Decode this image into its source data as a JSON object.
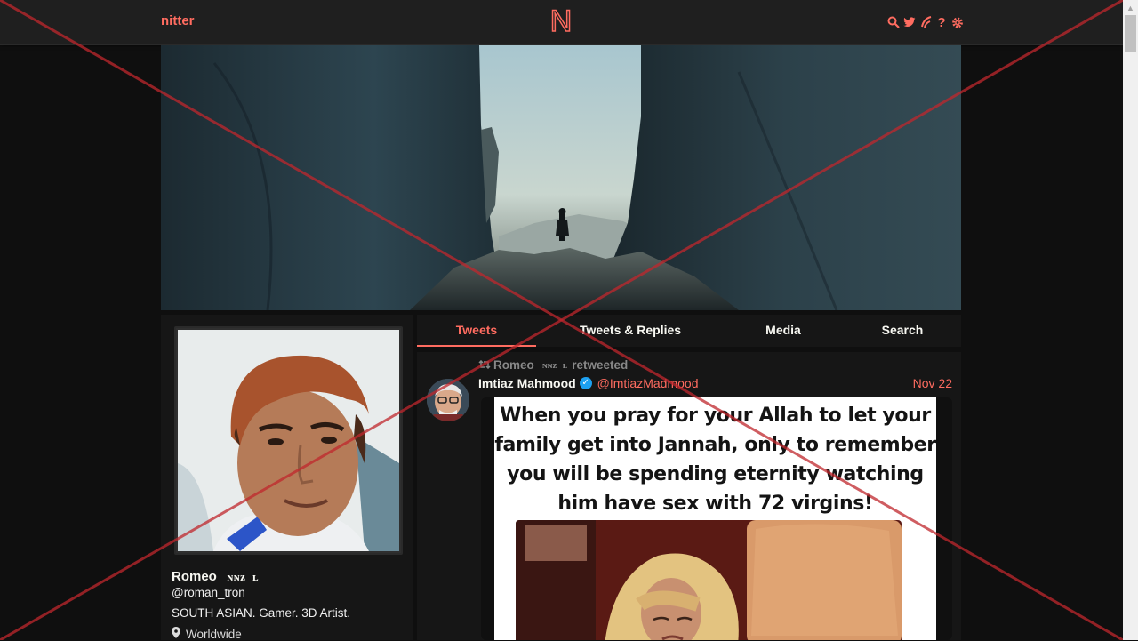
{
  "navbar": {
    "brand": "nitter",
    "icons": [
      "search-icon",
      "twitter-bird-icon",
      "rss-icon",
      "help-icon",
      "gear-icon"
    ]
  },
  "profile": {
    "fullname": "Romeo",
    "fullname_deco": "ɪɴɴᴢɪʟ",
    "username": "@roman_tron",
    "bio": "SOUTH ASIAN. Gamer. 3D Artist.",
    "location": "Worldwide"
  },
  "tabs": [
    {
      "label": "Tweets",
      "active": true
    },
    {
      "label": "Tweets & Replies",
      "active": false
    },
    {
      "label": "Media",
      "active": false
    },
    {
      "label": "Search",
      "active": false
    }
  ],
  "tweet": {
    "retweeter": "Romeo",
    "retweeter_deco": "ɪɴɴᴢɪʟ",
    "retweet_suffix": "retweeted",
    "author_name": "Imtiaz Mahmood",
    "author_handle": "@ImtiazMadmood",
    "date": "Nov 22",
    "verified": true,
    "image_text": "When you pray for your Allah to let your family get into Jannah, only to remember you will be spending eternity watching him have sex with 72 virgins!"
  },
  "colors": {
    "accent": "#ff6c60",
    "background": "#0f0f0f",
    "panel": "#161616",
    "navbar": "#1f1f1f",
    "overlay_cross": "#c0272d"
  }
}
